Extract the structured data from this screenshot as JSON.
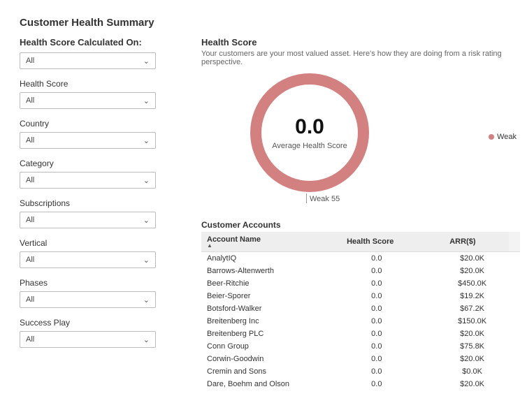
{
  "page_title": "Customer Health Summary",
  "filters": {
    "primary_label": "Health Score Calculated On:",
    "primary_value": "All",
    "items": [
      {
        "label": "Health Score",
        "value": "All"
      },
      {
        "label": "Country",
        "value": "All"
      },
      {
        "label": "Category",
        "value": "All"
      },
      {
        "label": "Subscriptions",
        "value": "All"
      },
      {
        "label": "Vertical",
        "value": "All"
      },
      {
        "label": "Phases",
        "value": "All"
      },
      {
        "label": "Success Play",
        "value": "All"
      }
    ]
  },
  "health_score": {
    "title": "Health Score",
    "subtitle": "Your customers are your most valued asset. Here's how they are doing from a risk rating perspective.",
    "gauge_value": "0.0",
    "gauge_label": "Average Health Score",
    "tick_label": "Weak 55",
    "legend_label": "Weak",
    "color_weak": "#d38080"
  },
  "accounts": {
    "title": "Customer  Accounts",
    "columns": [
      "Account Name",
      "Health Score",
      "ARR($)"
    ],
    "rows": [
      {
        "name": "AnalytIQ",
        "score": "0.0",
        "arr": "$20.0K"
      },
      {
        "name": "Barrows-Altenwerth",
        "score": "0.0",
        "arr": "$20.0K"
      },
      {
        "name": "Beer-Ritchie",
        "score": "0.0",
        "arr": "$450.0K"
      },
      {
        "name": "Beier-Sporer",
        "score": "0.0",
        "arr": "$19.2K"
      },
      {
        "name": "Botsford-Walker",
        "score": "0.0",
        "arr": "$67.2K"
      },
      {
        "name": "Breitenberg Inc",
        "score": "0.0",
        "arr": "$150.0K"
      },
      {
        "name": "Breitenberg PLC",
        "score": "0.0",
        "arr": "$20.0K"
      },
      {
        "name": "Conn Group",
        "score": "0.0",
        "arr": "$75.8K"
      },
      {
        "name": "Corwin-Goodwin",
        "score": "0.0",
        "arr": "$20.0K"
      },
      {
        "name": "Cremin and Sons",
        "score": "0.0",
        "arr": "$0.0K"
      },
      {
        "name": "Dare, Boehm and Olson",
        "score": "0.0",
        "arr": "$20.0K"
      }
    ]
  },
  "chart_data": {
    "type": "pie",
    "title": "Health Score",
    "center_value": 0.0,
    "center_label": "Average Health Score",
    "series": [
      {
        "name": "Weak",
        "value": 55
      }
    ],
    "legend": [
      "Weak"
    ],
    "colors": {
      "Weak": "#d38080"
    }
  }
}
